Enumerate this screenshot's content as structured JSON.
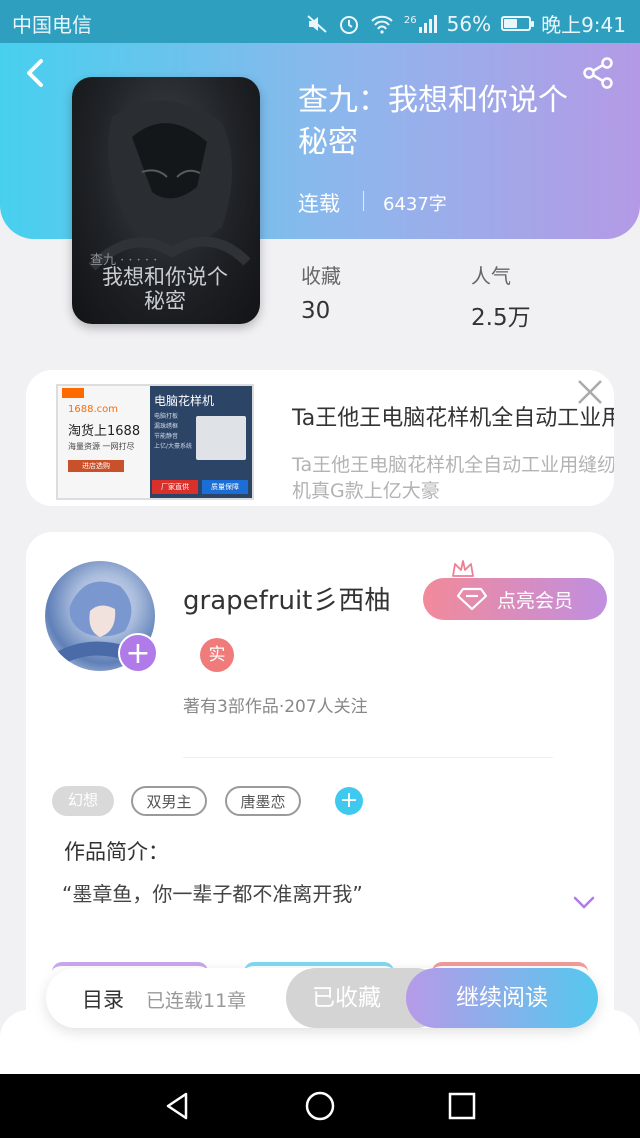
{
  "status_bar": {
    "carrier": "中国电信",
    "signal_label": "26",
    "battery": "56%",
    "time": "晚上9:41",
    "battery_level": 0.56
  },
  "book": {
    "title": "查九：我想和你说个秘密",
    "status": "连载",
    "word_count": "6437字",
    "stats": [
      {
        "label": "收藏",
        "value": "30"
      },
      {
        "label": "人气",
        "value": "2.5万"
      }
    ]
  },
  "ad": {
    "title": "Ta王他王电脑花样机全自动工业用缝纫机",
    "description": "Ta王他王电脑花样机全自动工业用缝纫机真G款上亿大豪",
    "image_left": {
      "site": "1688.com",
      "headline": "淘货上1688",
      "sub": "海量资源 一网打尽",
      "cta": "进店选购"
    },
    "image_right": {
      "title": "电脑花样机",
      "features": [
        "电脑打板",
        "漏珠绣框",
        "节能静音",
        "上亿/大豪系统"
      ],
      "tag1": "厂家直供",
      "tag2": "质量保障"
    }
  },
  "author": {
    "name": "grapefruit彡西柚",
    "real_badge": "实",
    "vip_button": "点亮会员",
    "meta": "著有3部作品·207人关注",
    "tags": [
      "幻想",
      "双男主",
      "唐墨恋"
    ],
    "intro_label": "作品简介：",
    "intro_text": "“墨章鱼，你一辈子都不准离开我”"
  },
  "bottom_bar": {
    "toc": "目录",
    "chapters": "已连载11章",
    "favorited": "已收藏",
    "continue": "继续阅读"
  },
  "colors": {
    "header_start": "#47d0ee",
    "header_end": "#b49ae6",
    "accent_purple": "#b07be8",
    "accent_cyan": "#3fc9ef"
  },
  "icons": [
    "back-icon",
    "share-icon",
    "close-icon",
    "diamond-icon",
    "crown-icon",
    "chevron-down-icon",
    "nav-back-icon",
    "nav-home-icon",
    "nav-recents-icon"
  ]
}
